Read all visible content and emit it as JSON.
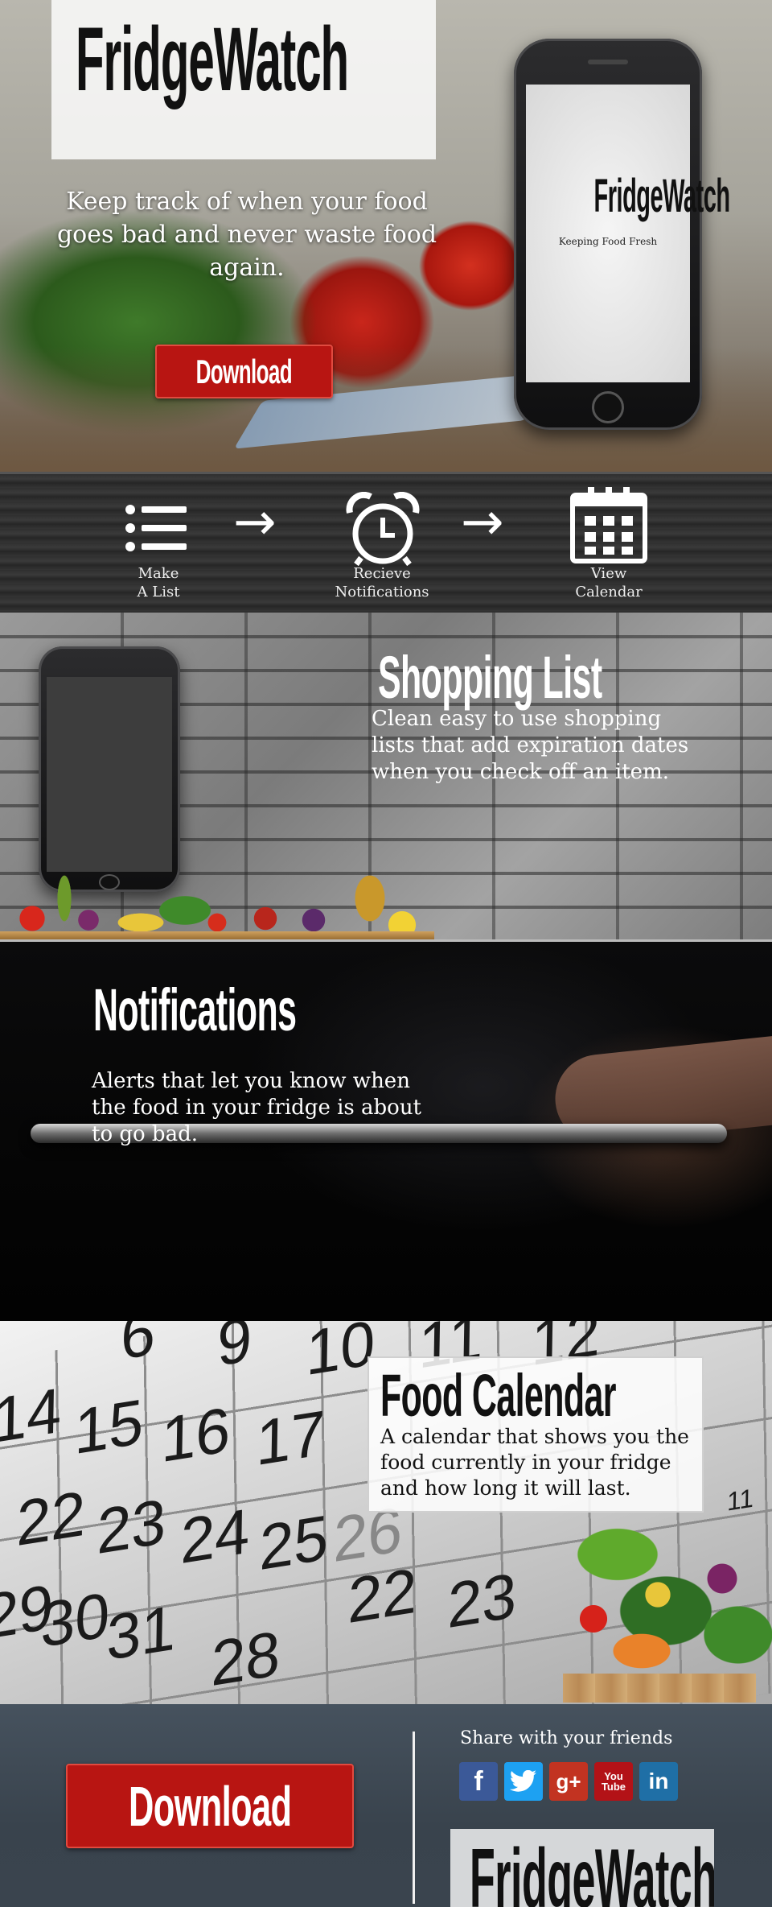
{
  "hero": {
    "logo": "FridgeWatch",
    "tagline": "Keep track of when your food goes bad and never waste food again.",
    "download_label": "Download",
    "phone_logo": "FridgeWatch",
    "phone_tagline": "Keeping Food Fresh"
  },
  "steps": [
    {
      "label_line1": "Make",
      "label_line2": "A List",
      "icon": "list-icon"
    },
    {
      "label_line1": "Recieve",
      "label_line2": "Notifications",
      "icon": "alarm-clock-icon"
    },
    {
      "label_line1": "View",
      "label_line2": "Calendar",
      "icon": "calendar-icon"
    }
  ],
  "shopping": {
    "title": "Shopping List",
    "body": "Clean easy to use shopping lists that add expiration dates when you check off an item."
  },
  "notifications": {
    "title": "Notifications",
    "body": "Alerts that let you know when the food in your fridge is about to go bad."
  },
  "calendar": {
    "title": "Food Calendar",
    "body": "A calendar that shows you the food currently in your fridge and how long it will last.",
    "numbers": [
      "6",
      "9",
      "10",
      "11",
      "12",
      "14",
      "15",
      "16",
      "17",
      "22",
      "23",
      "24",
      "25",
      "26",
      "29",
      "30",
      "31",
      "22",
      "23",
      "28",
      "11"
    ]
  },
  "footer": {
    "download_label": "Download",
    "share_label": "Share with your friends",
    "social": [
      {
        "name": "facebook",
        "glyph": "f",
        "color": "#3b5998"
      },
      {
        "name": "twitter",
        "glyph": "t",
        "color": "#1da1f2"
      },
      {
        "name": "google-plus",
        "glyph": "g+",
        "color": "#c23321"
      },
      {
        "name": "youtube",
        "glyph": "You Tube",
        "color": "#b31217"
      },
      {
        "name": "linkedin",
        "glyph": "in",
        "color": "#1f6fa6"
      }
    ],
    "logo": "FridgeWatch"
  },
  "colors": {
    "accent_red": "#b81512",
    "footer_bg": "#3f4a55"
  }
}
